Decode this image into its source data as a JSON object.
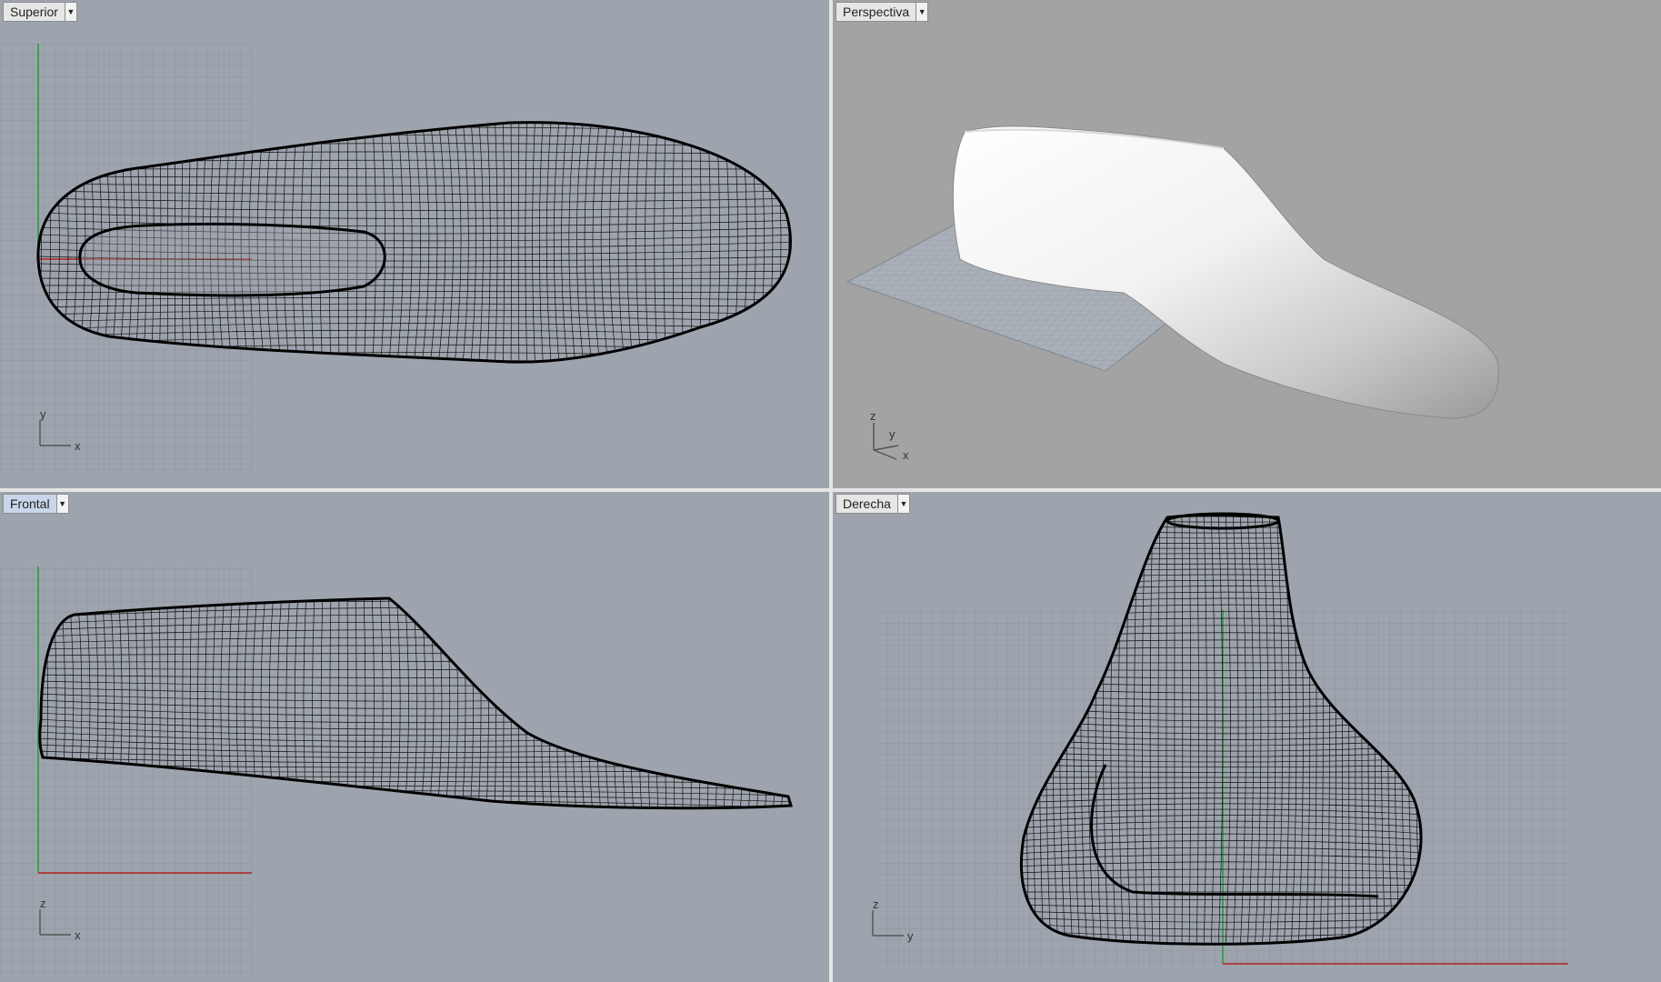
{
  "viewports": {
    "top": {
      "title": "Superior",
      "axis_a": "y",
      "axis_b": "x"
    },
    "persp": {
      "title": "Perspectiva",
      "axis_a": "z",
      "axis_b": "y",
      "axis_c": "x"
    },
    "front": {
      "title": "Frontal",
      "axis_a": "z",
      "axis_b": "x"
    },
    "right": {
      "title": "Derecha",
      "axis_a": "z",
      "axis_b": "y"
    }
  },
  "active_viewport": "Frontal",
  "colors": {
    "viewport_bg": "#9ea4ad",
    "perspective_bg": "#a3a3a3",
    "grid_line": "#8a9099",
    "x_axis": "#b22222",
    "y_axis": "#1f9e3a",
    "wireframe": "#111111",
    "shaded_model": "#f2f2f2"
  },
  "icons": {
    "viewport_menu": "dropdown-arrow-icon"
  }
}
